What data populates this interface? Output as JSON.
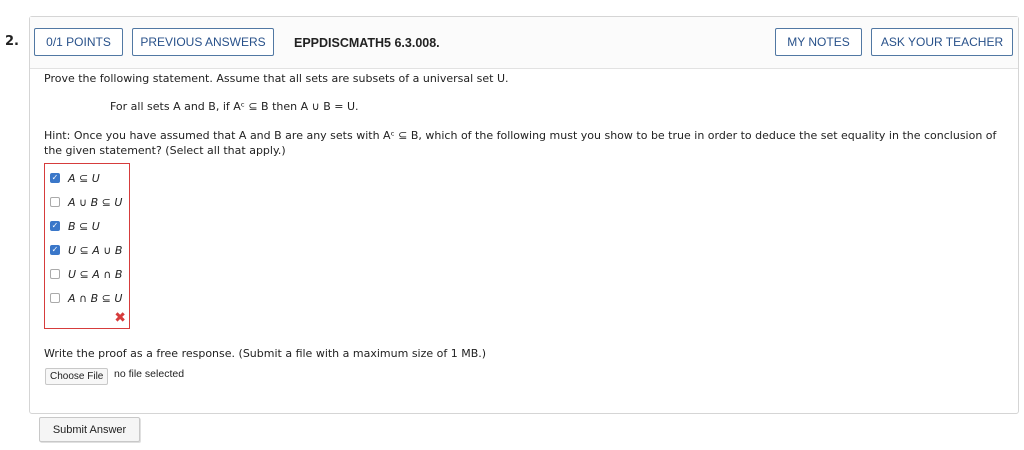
{
  "question_number": "2.",
  "header": {
    "points_label": "0/1 POINTS",
    "previous_answers_label": "PREVIOUS ANSWERS",
    "question_id": "EPPDISCMATH5 6.3.008.",
    "my_notes_label": "MY NOTES",
    "ask_teacher_label": "ASK YOUR TEACHER"
  },
  "body": {
    "prompt": "Prove the following statement. Assume that all sets are subsets of a universal set U.",
    "statement": "For all sets A and B, if Aᶜ ⊆ B then A ∪ B = U.",
    "hint_line1": "Hint: Once you have assumed that A and B are any sets with Aᶜ ⊆ B, which of the following must you show to be true in order to deduce the set equality in the conclusion of",
    "hint_line2": "the given statement? (Select all that apply.)"
  },
  "options": [
    {
      "label": "A ⊆ U",
      "checked": true
    },
    {
      "label": "A ∪ B ⊆ U",
      "checked": false
    },
    {
      "label": "B ⊆ U",
      "checked": true
    },
    {
      "label": "U ⊆ A ∪ B",
      "checked": true
    },
    {
      "label": "U ⊆ A ∩ B",
      "checked": false
    },
    {
      "label": "A ∩ B ⊆ U",
      "checked": false
    }
  ],
  "result_icon": "close-icon",
  "free_response": {
    "instruction": "Write the proof as a free response. (Submit a file with a maximum size of 1 MB.)",
    "choose_file_label": "Choose File",
    "file_status": "no file selected"
  },
  "submit_label": "Submit Answer",
  "colors": {
    "accent_blue": "#28518a",
    "checkbox_blue": "#3a77c9",
    "error_red": "#d63c3c"
  }
}
